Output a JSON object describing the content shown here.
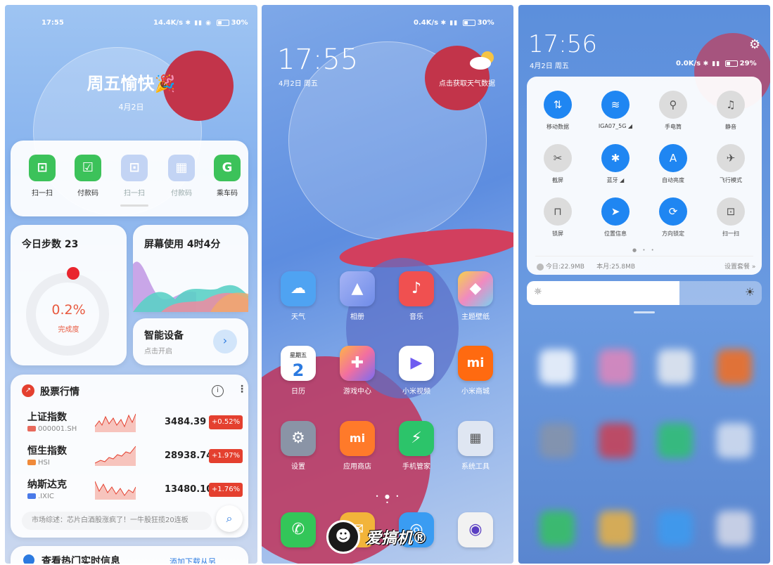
{
  "panel1": {
    "status": {
      "time": "17:55",
      "speed": "14.4K/s",
      "icons": "✱ ▮▮ ◉",
      "battery": "30"
    },
    "greeting": "周五愉快🎉",
    "date": "4月2日",
    "quick_actions": [
      {
        "label": "扫一扫",
        "icon": "scan-icon",
        "color": "#3cc25a"
      },
      {
        "label": "付款码",
        "icon": "pay-code-icon",
        "color": "#3cc25a"
      },
      {
        "label": "扫一扫",
        "icon": "scan-icon",
        "color": "#b9cdf3"
      },
      {
        "label": "付款码",
        "icon": "pay-code-icon",
        "color": "#b9cdf3"
      },
      {
        "label": "乘车码",
        "icon": "transit-code-icon",
        "color": "#3cc25a"
      }
    ],
    "steps": {
      "title": "今日步数 23",
      "percent": "0.2%",
      "sub": "完成度",
      "progress": 0.002
    },
    "screen_time": {
      "title": "屏幕使用 4时4分"
    },
    "devices": {
      "title": "智能设备",
      "sub": "点击开启"
    },
    "stocks": {
      "title": "股票行情",
      "rows": [
        {
          "name": "上证指数",
          "code": "000001.SH",
          "tag": "SH",
          "price": "3484.39",
          "change": "+0.52%"
        },
        {
          "name": "恒生指数",
          "code": "HSI",
          "tag": "HK",
          "price": "28938.74",
          "change": "+1.97%"
        },
        {
          "name": "纳斯达克",
          "code": ".IXIC",
          "tag": "US",
          "price": "13480.10",
          "change": "+1.76%"
        }
      ],
      "summary": "市场综述：芯片白酒股涨疯了！一牛股狂揽20连板"
    },
    "bottom_card": {
      "title": "查看热门实时信息",
      "link": "添加下载从另"
    }
  },
  "panel2": {
    "status": {
      "speed": "0.4K/s",
      "battery": "30"
    },
    "clock": "17:55",
    "date": "4月2日 周五",
    "weather_prompt": "点击获取天气数据",
    "apps": [
      {
        "label": "天气",
        "icon": "weather-icon",
        "color": "#4fa3f2",
        "glyph": "☁"
      },
      {
        "label": "相册",
        "icon": "gallery-icon",
        "color": "#8e9cf0",
        "glyph": "▲"
      },
      {
        "label": "音乐",
        "icon": "music-icon",
        "color": "#f05050",
        "glyph": "♪"
      },
      {
        "label": "主题壁纸",
        "icon": "theme-icon",
        "color": "#f08ac0",
        "glyph": "◆"
      },
      {
        "label": "日历",
        "icon": "calendar-icon",
        "color": "#ffffff",
        "glyph": "2",
        "day": "星期五"
      },
      {
        "label": "游戏中心",
        "icon": "game-center-icon",
        "color": "#f26fa0",
        "glyph": "✚"
      },
      {
        "label": "小米视频",
        "icon": "video-icon",
        "color": "#ffffff",
        "glyph": "▶"
      },
      {
        "label": "小米商城",
        "icon": "mi-store-icon",
        "color": "#ff6a10",
        "glyph": "mi"
      },
      {
        "label": "设置",
        "icon": "settings-icon",
        "color": "#8a94a6",
        "glyph": "⚙"
      },
      {
        "label": "应用商店",
        "icon": "app-store-icon",
        "color": "#ff7a2a",
        "glyph": "mi"
      },
      {
        "label": "手机管家",
        "icon": "security-icon",
        "color": "#2cc46a",
        "glyph": "⚡"
      },
      {
        "label": "系统工具",
        "icon": "system-tools-icon",
        "color": "#dfe6f2",
        "glyph": "▦"
      }
    ],
    "dock": [
      {
        "icon": "phone-icon",
        "color": "#33c659",
        "glyph": "✆"
      },
      {
        "icon": "messages-icon",
        "color": "#f2b43a",
        "glyph": "✉"
      },
      {
        "icon": "browser-icon",
        "color": "#3a9cf2",
        "glyph": "◎"
      },
      {
        "icon": "camera-icon",
        "color": "#f2f2f2",
        "glyph": "◉"
      }
    ],
    "watermark": "爱搞机®"
  },
  "panel3": {
    "clock": "17:56",
    "date": "4月2日 周五",
    "status": {
      "speed": "0.0K/s",
      "battery": "29"
    },
    "tiles": [
      {
        "label": "移动数据",
        "icon": "mobile-data-icon",
        "glyph": "⇅",
        "on": true
      },
      {
        "label": "IGA07_5G ◢",
        "icon": "wifi-icon",
        "glyph": "≋",
        "on": true
      },
      {
        "label": "手电筒",
        "icon": "flashlight-icon",
        "glyph": "⚲",
        "on": false
      },
      {
        "label": "静音",
        "icon": "bell-icon",
        "glyph": "♫",
        "on": false
      },
      {
        "label": "截屏",
        "icon": "screenshot-icon",
        "glyph": "✂",
        "on": false
      },
      {
        "label": "蓝牙 ◢",
        "icon": "bluetooth-icon",
        "glyph": "✱",
        "on": true
      },
      {
        "label": "自动亮度",
        "icon": "auto-brightness-icon",
        "glyph": "A",
        "on": true
      },
      {
        "label": "飞行模式",
        "icon": "airplane-icon",
        "glyph": "✈",
        "on": false
      },
      {
        "label": "锁屏",
        "icon": "lock-icon",
        "glyph": "⊓",
        "on": false
      },
      {
        "label": "位置信息",
        "icon": "location-icon",
        "glyph": "➤",
        "on": true
      },
      {
        "label": "方向锁定",
        "icon": "rotation-lock-icon",
        "glyph": "⟳",
        "on": true
      },
      {
        "label": "扫一扫",
        "icon": "scan-icon",
        "glyph": "⊡",
        "on": false
      }
    ],
    "usage_today": "今日:22.9MB",
    "usage_month": "本月:25.8MB",
    "data_plan": "设置套餐 »",
    "brightness": 0.65
  }
}
